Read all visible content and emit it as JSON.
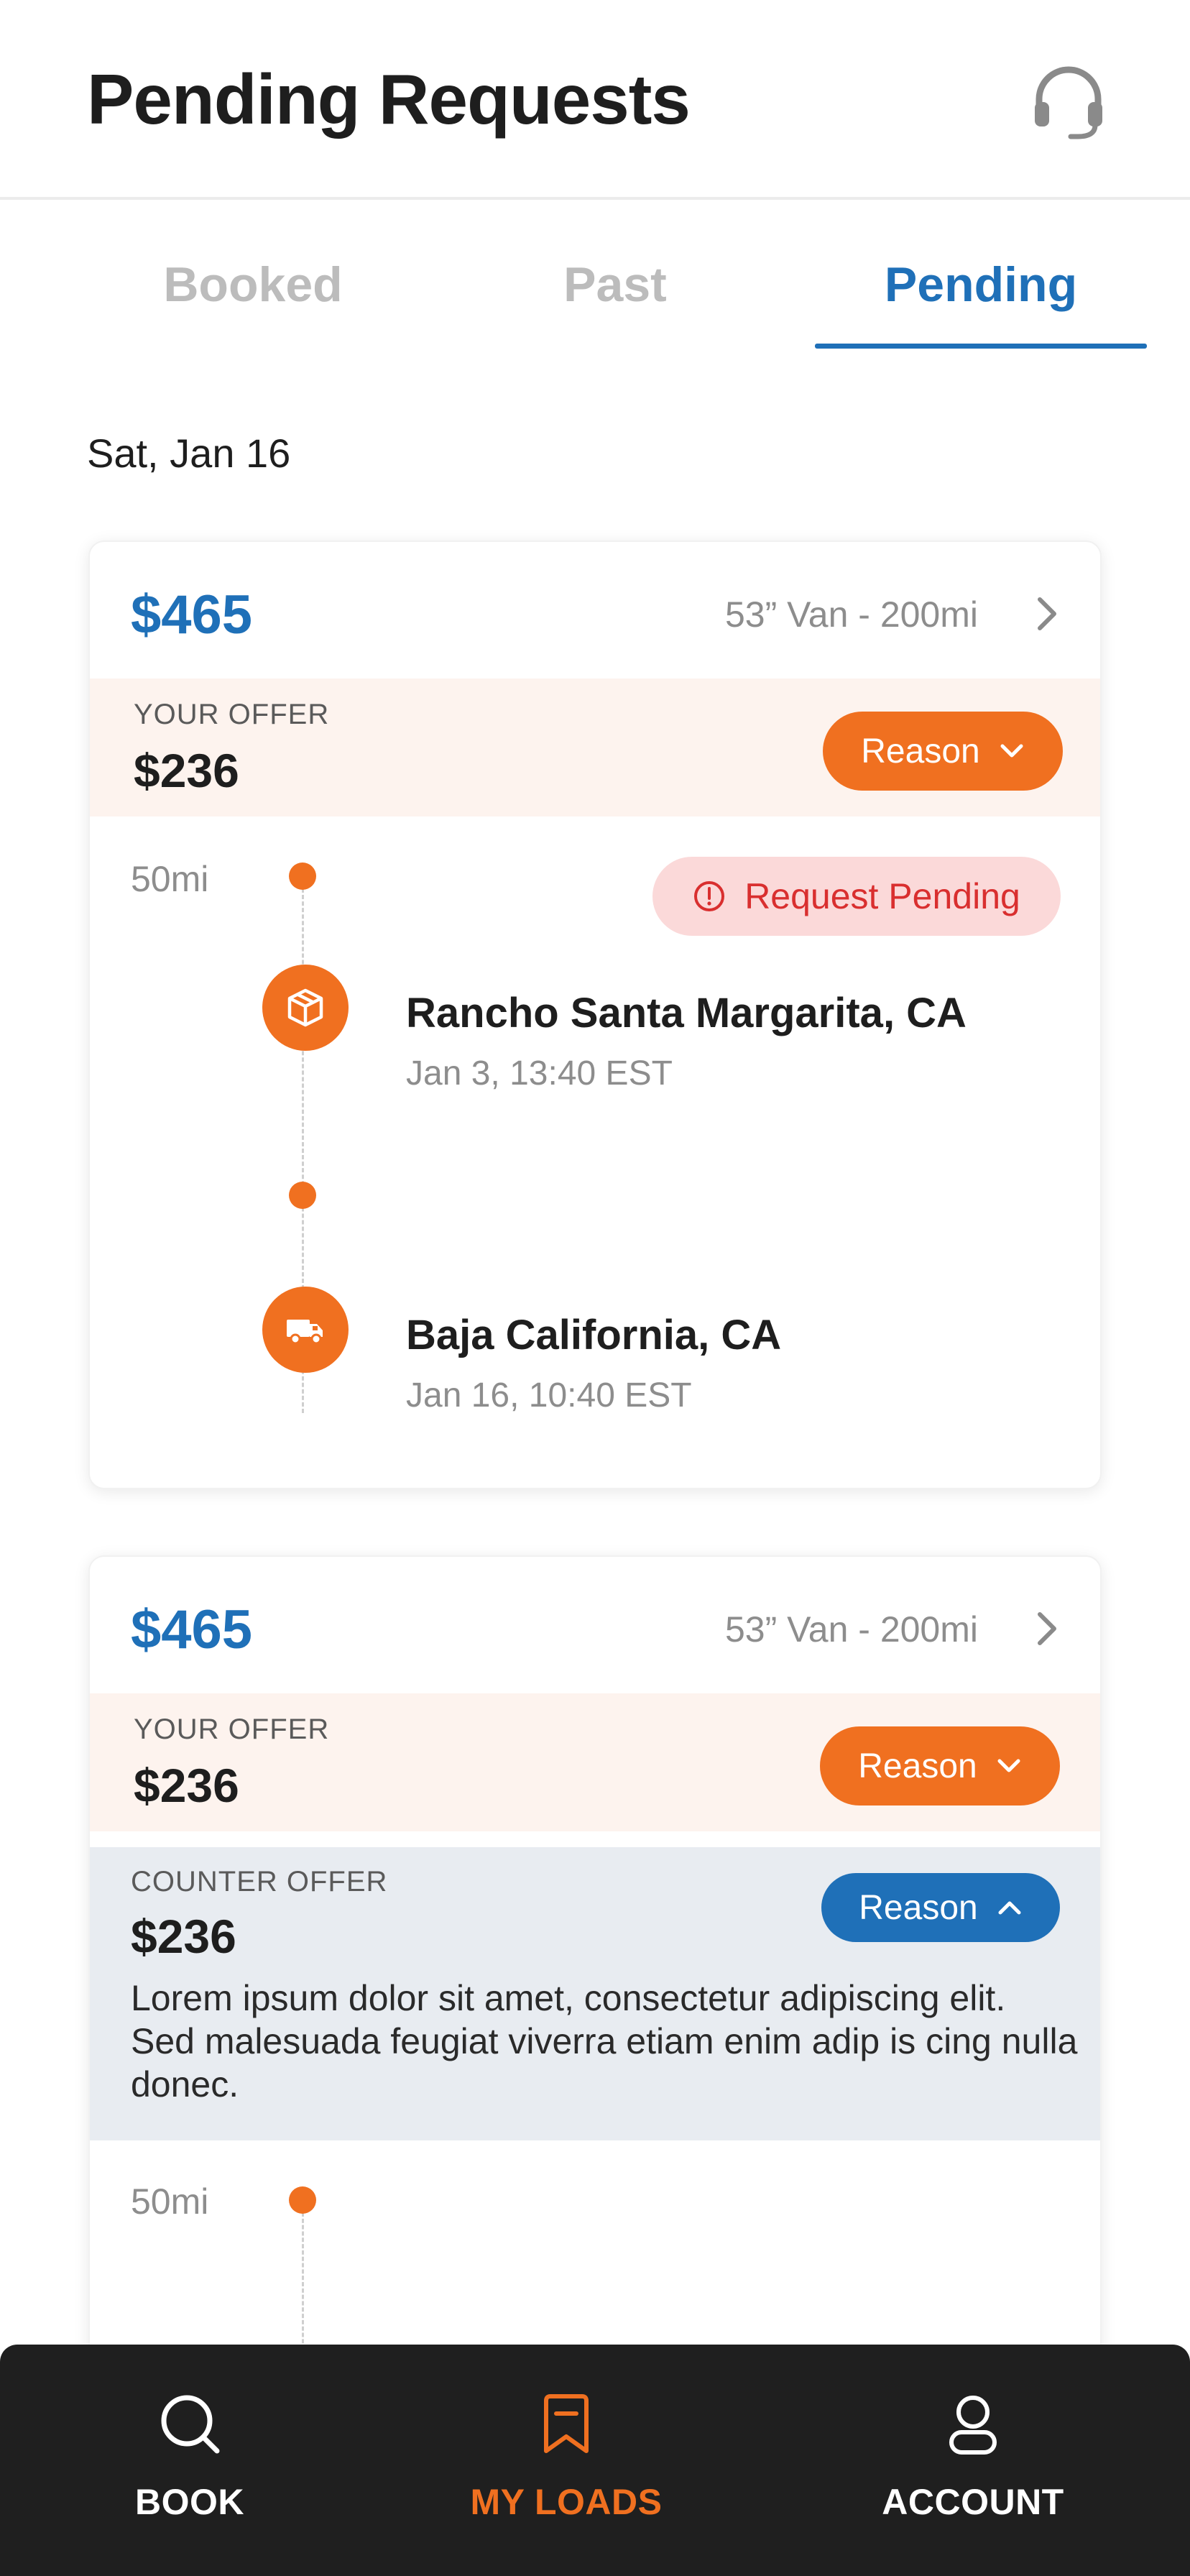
{
  "header": {
    "title": "Pending Requests",
    "support_icon": "headset-icon"
  },
  "tabs": [
    {
      "label": "Booked",
      "active": false
    },
    {
      "label": "Past",
      "active": false
    },
    {
      "label": "Pending",
      "active": true
    }
  ],
  "date_heading": "Sat, Jan 16",
  "cards": [
    {
      "price": "$465",
      "meta": "53” Van - 200mi",
      "your_offer": {
        "label": "YOUR OFFER",
        "value": "$236",
        "reason_label": "Reason"
      },
      "status": "Request Pending",
      "distance": "50mi",
      "stops": [
        {
          "type": "pickup",
          "icon": "package-icon",
          "name": "Rancho Santa Margarita, CA",
          "time": "Jan 3, 13:40 EST"
        },
        {
          "type": "dropoff",
          "icon": "truck-icon",
          "name": "Baja California, CA",
          "time": "Jan 16, 10:40 EST"
        }
      ]
    },
    {
      "price": "$465",
      "meta": "53” Van - 200mi",
      "your_offer": {
        "label": "YOUR OFFER",
        "value": "$236",
        "reason_label": "Reason"
      },
      "counter_offer": {
        "label": "COUNTER OFFER",
        "value": "$236",
        "reason_label": "Reason",
        "text": "Lorem ipsum dolor sit amet, consectetur adipiscing elit. Sed malesuada feugiat viverra etiam enim adip is cing nulla donec."
      },
      "distance": "50mi"
    }
  ],
  "bottom_nav": [
    {
      "label": "BOOK",
      "icon": "search-icon",
      "active": false
    },
    {
      "label": "MY LOADS",
      "icon": "bookmark-icon",
      "active": true
    },
    {
      "label": "ACCOUNT",
      "icon": "user-icon",
      "active": false
    }
  ],
  "colors": {
    "primary_blue": "#1f70b8",
    "accent_orange": "#f07020",
    "offer_band": "#fdf3ee",
    "counter_band": "#e8ecf1",
    "status_bg": "#fbd9d9",
    "status_text": "#d92f2f",
    "nav_bg": "#1f1f1f"
  }
}
